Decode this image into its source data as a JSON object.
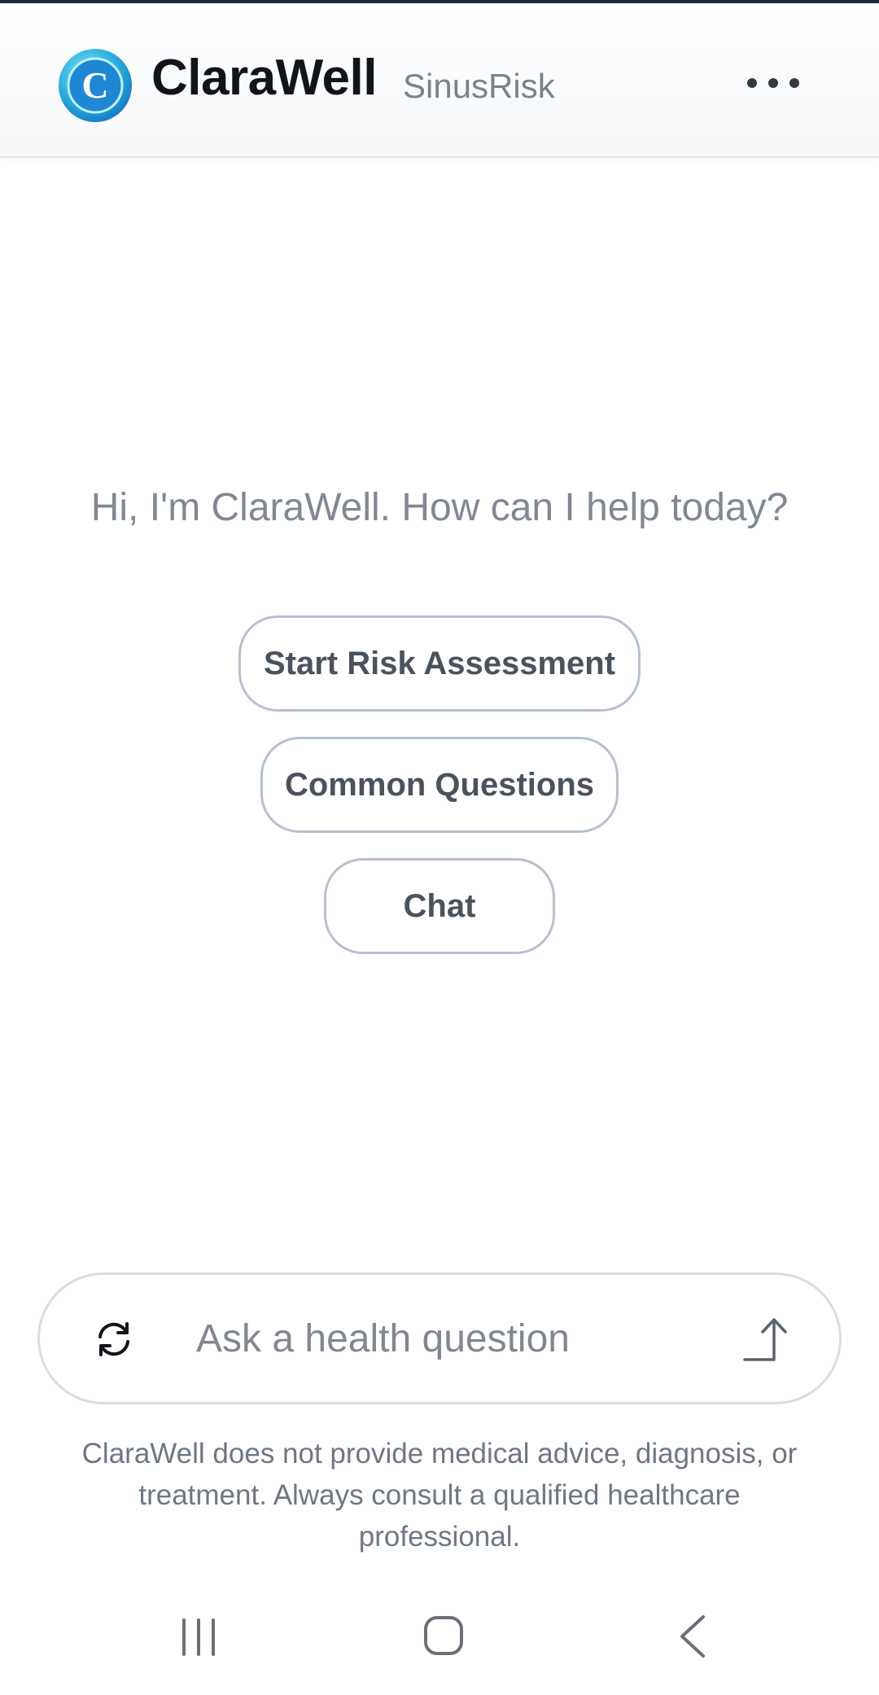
{
  "header": {
    "logo_letter": "C",
    "title": "ClaraWell",
    "subtitle": "SinusRisk",
    "menu_icon": "more-horizontal-icon"
  },
  "main": {
    "greeting": "Hi, I'm ClaraWell. How can I help today?",
    "actions": [
      {
        "label": "Start Risk Assessment"
      },
      {
        "label": "Common Questions"
      },
      {
        "label": "Chat"
      }
    ]
  },
  "composer": {
    "refresh_icon": "refresh-icon",
    "placeholder": "Ask a health question",
    "send_icon": "send-arrow-icon"
  },
  "disclaimer": "ClaraWell does not provide medical advice, diagnosis, or treatment. Always consult a qualified healthcare professional.",
  "system_nav": {
    "recents_icon": "recents-icon",
    "home_icon": "home-icon",
    "back_icon": "back-icon"
  },
  "colors": {
    "brand_blue": "#1e88d4",
    "brand_cyan": "#3ec6e6",
    "pill_border": "#b6c1cd",
    "text_muted": "#808893"
  }
}
